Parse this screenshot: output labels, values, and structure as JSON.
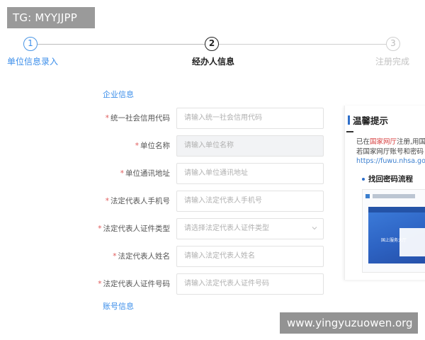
{
  "watermarks": {
    "top": "TG: MYYJJPP",
    "bottom": "www.yingyuzuowen.org"
  },
  "stepper": {
    "steps": [
      {
        "number": "1",
        "label": "单位信息录入",
        "state": "done"
      },
      {
        "number": "2",
        "label": "经办人信息",
        "state": "current"
      },
      {
        "number": "3",
        "label": "注册完成",
        "state": "pending"
      }
    ]
  },
  "form": {
    "section_company": "企业信息",
    "section_account": "账号信息",
    "required_mark": "*",
    "fields": [
      {
        "label": "统一社会信用代码",
        "placeholder": "请输入统一社会信用代码",
        "required": true,
        "type": "text"
      },
      {
        "label": "单位名称",
        "placeholder": "请输入单位名称",
        "required": true,
        "type": "disabled"
      },
      {
        "label": "单位通讯地址",
        "placeholder": "请输入单位通讯地址",
        "required": true,
        "type": "text"
      },
      {
        "label": "法定代表人手机号",
        "placeholder": "请输入法定代表人手机号",
        "required": true,
        "type": "text"
      },
      {
        "label": "法定代表人证件类型",
        "placeholder": "请选择法定代表人证件类型",
        "required": true,
        "type": "select"
      },
      {
        "label": "法定代表人姓名",
        "placeholder": "请输入法定代表人姓名",
        "required": true,
        "type": "text"
      },
      {
        "label": "法定代表人证件号码",
        "placeholder": "请输入法定代表人证件号码",
        "required": true,
        "type": "text"
      }
    ]
  },
  "tips": {
    "title": "温馨提示",
    "text_before": "已在",
    "text_highlight": "国家网厅",
    "text_after": "注册,用国",
    "text_line2": "若国家网厅账号和密码",
    "link": "https://fuwu.nhsa.go",
    "subheading": "找回密码流程",
    "mock_text": "国上服务大厅"
  },
  "colors": {
    "accent": "#3b8eea",
    "required": "#e05a5a",
    "highlight": "#d63c3c"
  }
}
